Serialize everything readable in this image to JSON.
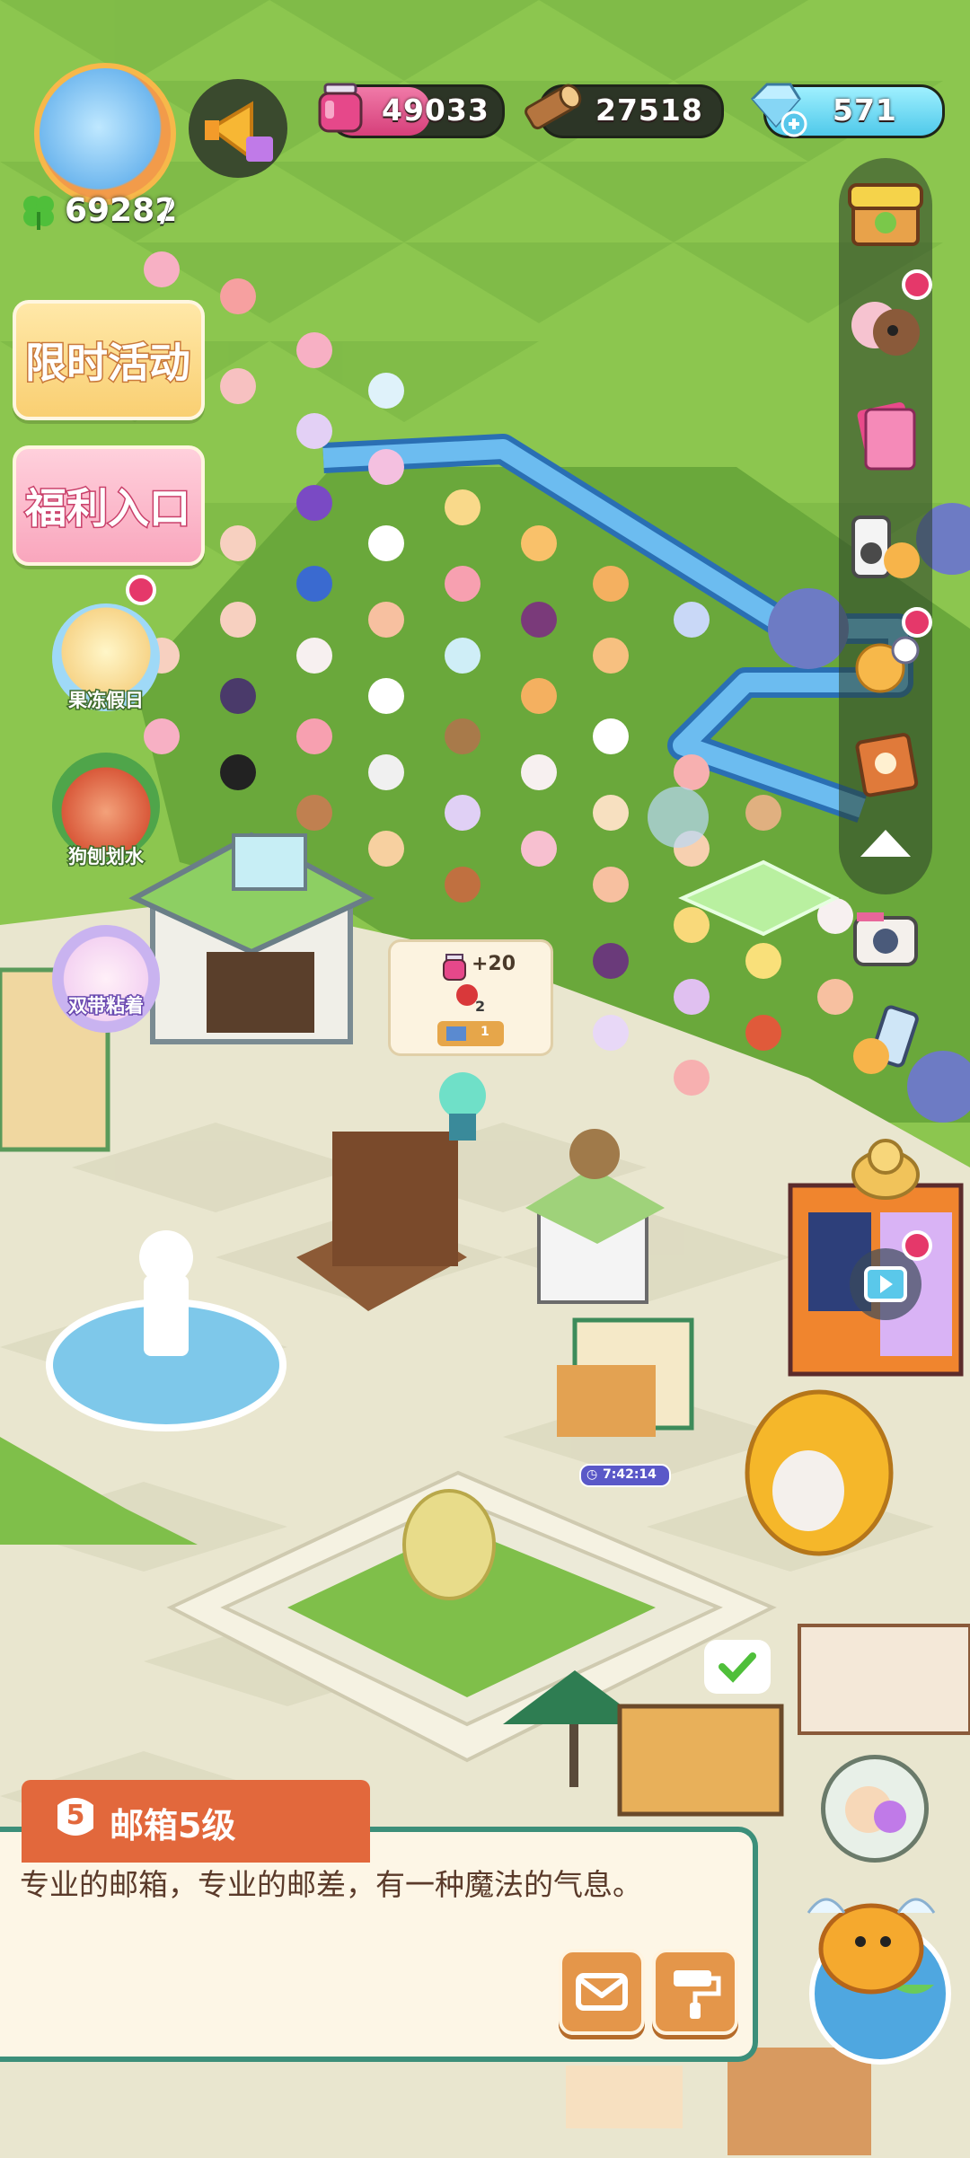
{
  "resources": {
    "gem_jar": "49033",
    "wood": "27518",
    "diamond": "571",
    "clover_score": "69282"
  },
  "left_menu": {
    "limited_event": "限时活动",
    "welfare": "福利入口",
    "jelly_holiday": "果冻假日",
    "dog_paddle": "狗刨划水",
    "double_feature": "双带粘着"
  },
  "building_popup": {
    "reward_label": "+20",
    "item_count": "2",
    "ticket_count": "1"
  },
  "timer": "7:42:14",
  "info_panel": {
    "level": "5",
    "title": "邮箱5级",
    "description": "专业的邮箱，专业的邮差，有一种魔法的气息。"
  },
  "colors": {
    "grass": "#7fbf4a",
    "plaza": "#ede8d4",
    "river": "#4a9fe0",
    "panel_border": "#3c8f7a",
    "title_bar": "#e2683c",
    "badge": "#e5386a"
  },
  "icons": {
    "gem_jar": "pink-jar-icon",
    "wood": "log-icon",
    "diamond": "blue-gem-plus-icon",
    "clover": "clover-icon",
    "megaphone": "megaphone-icon"
  }
}
